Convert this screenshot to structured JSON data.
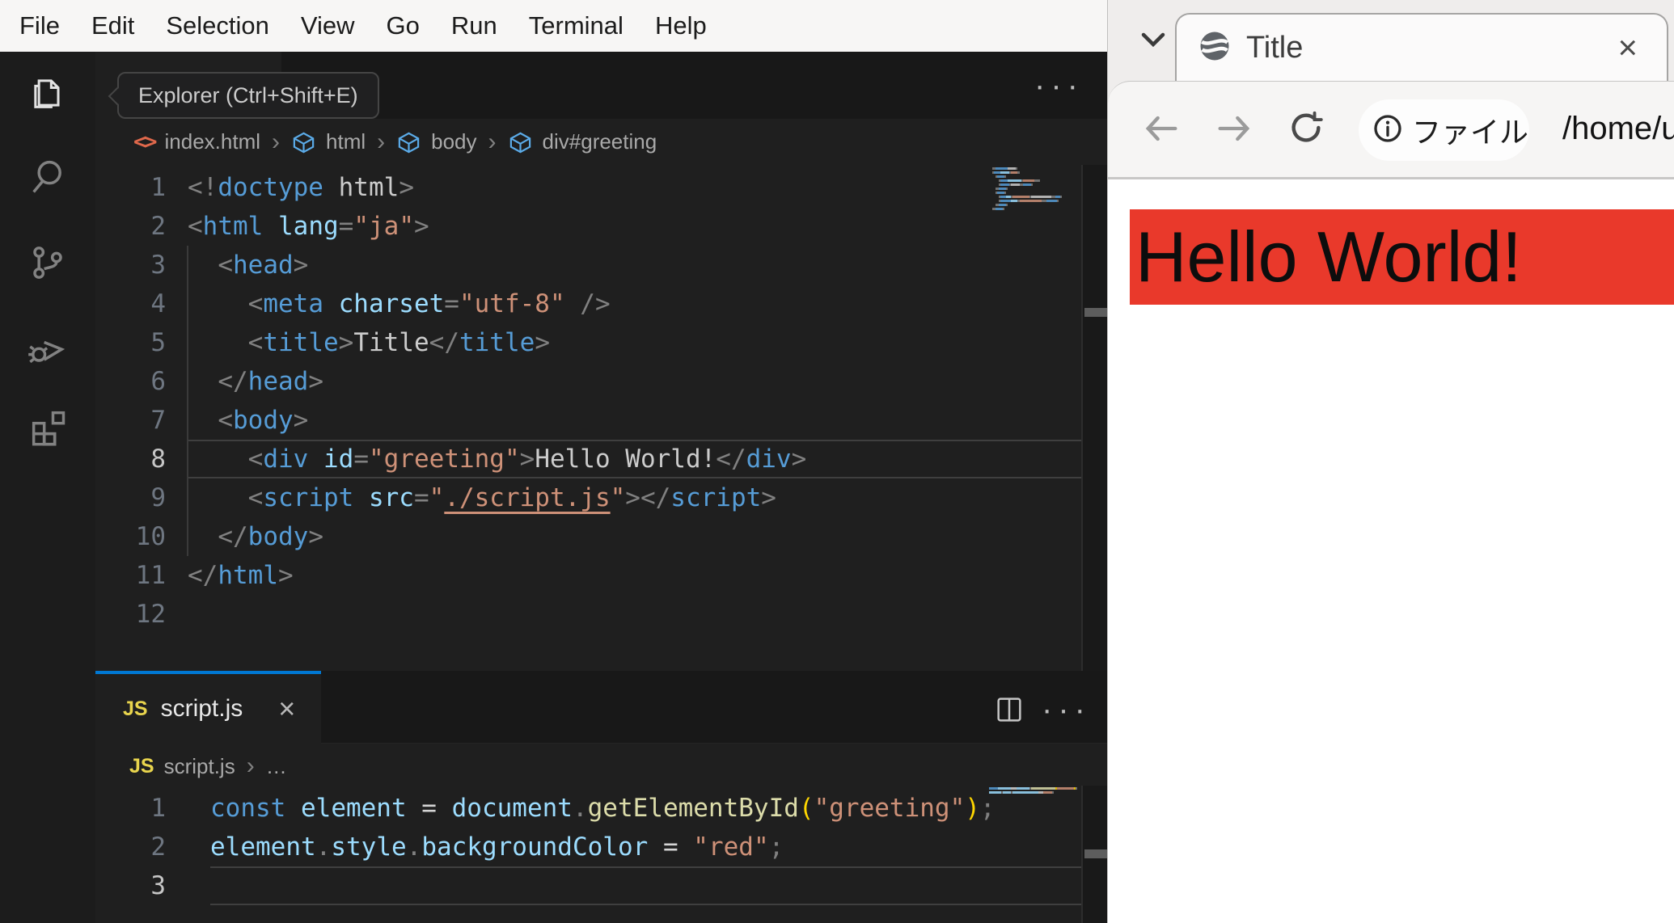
{
  "menu": {
    "items": [
      "File",
      "Edit",
      "Selection",
      "View",
      "Go",
      "Run",
      "Terminal",
      "Help"
    ]
  },
  "activity_bar": {
    "tooltip": "Explorer (Ctrl+Shift+E)"
  },
  "icons": {
    "more": "···",
    "close": "×",
    "html_glyph": "<>",
    "js_glyph": "JS"
  },
  "editor1": {
    "tab": "index.html",
    "breadcrumb": {
      "file": "index.html",
      "path": [
        "html",
        "body",
        "div#greeting"
      ]
    },
    "active_line": 8,
    "lines": [
      [
        [
          "p",
          "<!"
        ],
        [
          "tag",
          "doctype"
        ],
        [
          "text",
          " html"
        ],
        [
          "p",
          ">"
        ]
      ],
      [
        [
          "p",
          "<"
        ],
        [
          "tag",
          "html"
        ],
        [
          "attr",
          " lang"
        ],
        [
          "p",
          "="
        ],
        [
          "str",
          "\"ja\""
        ],
        [
          "p",
          ">"
        ]
      ],
      [
        [
          "text",
          "  "
        ],
        [
          "p",
          "<"
        ],
        [
          "tag",
          "head"
        ],
        [
          "p",
          ">"
        ]
      ],
      [
        [
          "text",
          "    "
        ],
        [
          "p",
          "<"
        ],
        [
          "tag",
          "meta"
        ],
        [
          "attr",
          " charset"
        ],
        [
          "p",
          "="
        ],
        [
          "str",
          "\"utf-8\""
        ],
        [
          "p",
          " />"
        ]
      ],
      [
        [
          "text",
          "    "
        ],
        [
          "p",
          "<"
        ],
        [
          "tag",
          "title"
        ],
        [
          "p",
          ">"
        ],
        [
          "text",
          "Title"
        ],
        [
          "p",
          "</"
        ],
        [
          "tag",
          "title"
        ],
        [
          "p",
          ">"
        ]
      ],
      [
        [
          "text",
          "  "
        ],
        [
          "p",
          "</"
        ],
        [
          "tag",
          "head"
        ],
        [
          "p",
          ">"
        ]
      ],
      [
        [
          "text",
          "  "
        ],
        [
          "p",
          "<"
        ],
        [
          "tag",
          "body"
        ],
        [
          "p",
          ">"
        ]
      ],
      [
        [
          "text",
          "    "
        ],
        [
          "p",
          "<"
        ],
        [
          "tag",
          "div"
        ],
        [
          "attr",
          " id"
        ],
        [
          "p",
          "="
        ],
        [
          "str",
          "\"greeting\""
        ],
        [
          "p",
          ">"
        ],
        [
          "text",
          "Hello World!"
        ],
        [
          "p",
          "</"
        ],
        [
          "tag",
          "div"
        ],
        [
          "p",
          ">"
        ]
      ],
      [
        [
          "text",
          "    "
        ],
        [
          "p",
          "<"
        ],
        [
          "tag",
          "script"
        ],
        [
          "attr",
          " src"
        ],
        [
          "p",
          "="
        ],
        [
          "str",
          "\""
        ],
        [
          "link",
          "./script.js"
        ],
        [
          "str",
          "\""
        ],
        [
          "p",
          ">"
        ],
        [
          "p",
          "</"
        ],
        [
          "tag",
          "script"
        ],
        [
          "p",
          ">"
        ]
      ],
      [
        [
          "text",
          "  "
        ],
        [
          "p",
          "</"
        ],
        [
          "tag",
          "body"
        ],
        [
          "p",
          ">"
        ]
      ],
      [
        [
          "p",
          "</"
        ],
        [
          "tag",
          "html"
        ],
        [
          "p",
          ">"
        ]
      ],
      []
    ]
  },
  "editor2": {
    "tab": "script.js",
    "breadcrumb": {
      "file": "script.js",
      "more": "…"
    },
    "active_line": 3,
    "lines": [
      [
        [
          "kw",
          "const"
        ],
        [
          "var",
          " element"
        ],
        [
          "op",
          " = "
        ],
        [
          "var",
          "document"
        ],
        [
          "p",
          "."
        ],
        [
          "fn",
          "getElementById"
        ],
        [
          "br1",
          "("
        ],
        [
          "str",
          "\"greeting\""
        ],
        [
          "br1",
          ")"
        ],
        [
          "p",
          ";"
        ]
      ],
      [
        [
          "var",
          "element"
        ],
        [
          "p",
          "."
        ],
        [
          "var",
          "style"
        ],
        [
          "p",
          "."
        ],
        [
          "var",
          "backgroundColor"
        ],
        [
          "op",
          " = "
        ],
        [
          "str",
          "\"red\""
        ],
        [
          "p",
          ";"
        ]
      ],
      []
    ]
  },
  "browser": {
    "tab_title": "Title",
    "url_chip": "ファイル",
    "url": "/home/u",
    "page": {
      "text": "Hello World!",
      "bg": "#e9392b"
    }
  },
  "colors": {
    "accent_tab_border": "#0078d4",
    "page_banner_red": "#e9392b"
  }
}
